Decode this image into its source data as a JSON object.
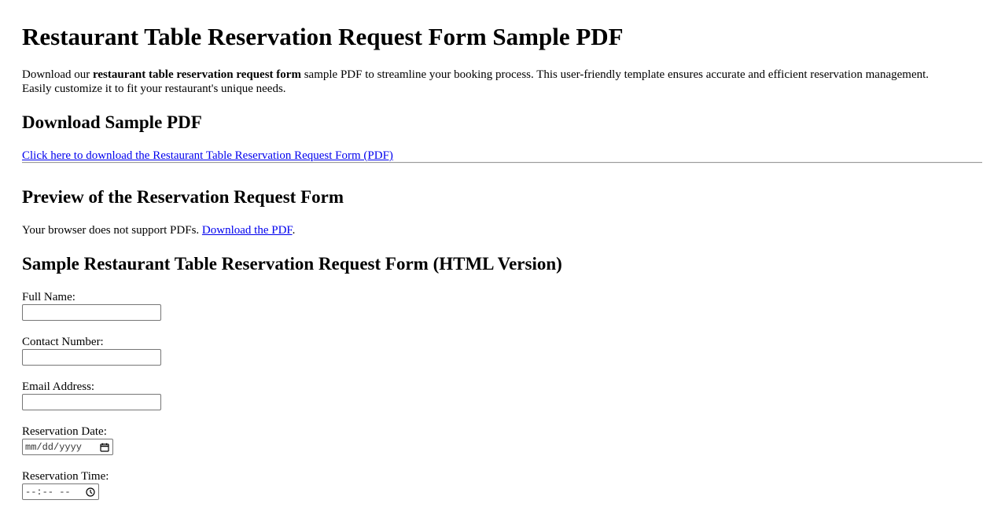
{
  "page": {
    "title": "Restaurant Table Reservation Request Form Sample PDF",
    "intro": {
      "before": "Download our ",
      "bold": "restaurant table reservation request form",
      "after": " sample PDF to streamline your booking process. This user-friendly template ensures accurate and efficient reservation management. Easily customize it to fit your restaurant's unique needs."
    }
  },
  "download_section": {
    "heading": "Download Sample PDF",
    "link_text": "Click here to download the Restaurant Table Reservation Request Form (PDF)"
  },
  "preview_section": {
    "heading": "Preview of the Reservation Request Form",
    "fallback_text": "Your browser does not support PDFs. ",
    "fallback_link": "Download the PDF",
    "fallback_end": "."
  },
  "form_section": {
    "heading": "Sample Restaurant Table Reservation Request Form (HTML Version)",
    "fields": {
      "full_name": {
        "label": "Full Name:",
        "value": ""
      },
      "contact_number": {
        "label": "Contact Number:",
        "value": ""
      },
      "email": {
        "label": "Email Address:",
        "value": ""
      },
      "date": {
        "label": "Reservation Date:",
        "placeholder": "mm/dd/yyyy",
        "icon": "calendar-icon"
      },
      "time": {
        "label": "Reservation Time:",
        "placeholder": "--:-- --",
        "icon": "clock-icon"
      }
    }
  }
}
